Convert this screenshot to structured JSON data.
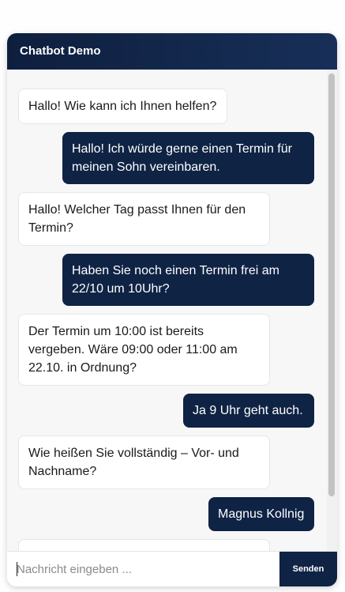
{
  "header": {
    "title": "Chatbot Demo"
  },
  "messages": [
    {
      "role": "bot",
      "text": "Hallo! Wie kann ich Ihnen helfen?"
    },
    {
      "role": "user",
      "text": "Hallo! Ich würde gerne einen Termin für meinen Sohn vereinbaren."
    },
    {
      "role": "bot",
      "text": "Hallo! Welcher Tag passt Ihnen für den Termin?"
    },
    {
      "role": "user",
      "text": "Haben Sie noch einen Termin frei am 22/10 um 10Uhr?"
    },
    {
      "role": "bot",
      "text": "Der Termin um 10:00 ist bereits vergeben. Wäre 09:00 oder 11:00 am 22.10. in Ordnung?"
    },
    {
      "role": "user",
      "text": "Ja 9 Uhr geht auch."
    },
    {
      "role": "bot",
      "text": "Wie heißen Sie vollständig – Vor- und Nachname?"
    },
    {
      "role": "user",
      "text": "Magnus Kollnig"
    },
    {
      "role": "bot",
      "text": ""
    }
  ],
  "composer": {
    "placeholder": "Nachricht eingeben ...",
    "value": "",
    "send_label": "Senden"
  },
  "colors": {
    "header": "#0e1f3e",
    "user_bubble": "#0f2344",
    "bot_bubble": "#ffffff",
    "send_button": "#0f2344"
  }
}
